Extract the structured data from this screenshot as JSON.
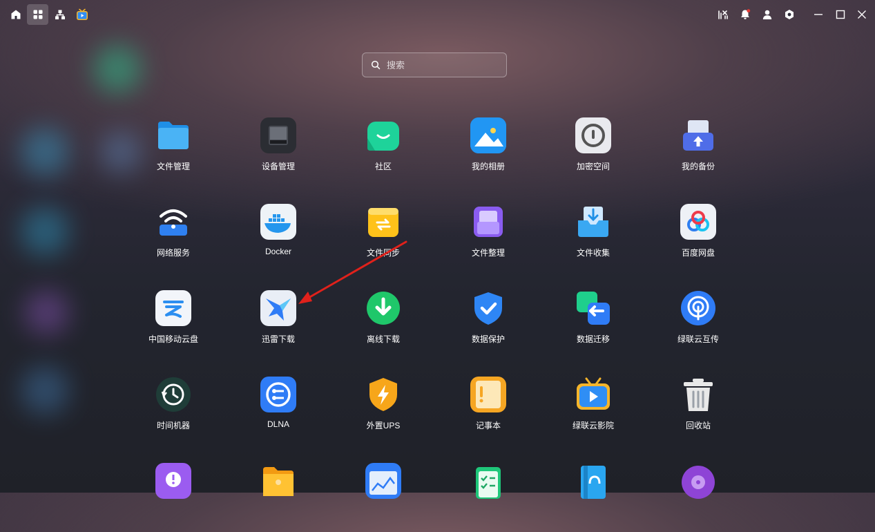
{
  "search": {
    "placeholder": "搜索"
  },
  "apps": [
    {
      "label": "文件管理",
      "icon": "folder-icon"
    },
    {
      "label": "设备管理",
      "icon": "device-icon"
    },
    {
      "label": "社区",
      "icon": "community-icon"
    },
    {
      "label": "我的相册",
      "icon": "album-icon"
    },
    {
      "label": "加密空间",
      "icon": "encrypted-space-icon"
    },
    {
      "label": "我的备份",
      "icon": "backup-icon"
    },
    {
      "label": "网络服务",
      "icon": "network-service-icon"
    },
    {
      "label": "Docker",
      "icon": "docker-icon"
    },
    {
      "label": "文件同步",
      "icon": "file-sync-icon"
    },
    {
      "label": "文件整理",
      "icon": "file-organize-icon"
    },
    {
      "label": "文件收集",
      "icon": "file-collect-icon"
    },
    {
      "label": "百度网盘",
      "icon": "baidu-pan-icon"
    },
    {
      "label": "中国移动云盘",
      "icon": "china-mobile-cloud-icon"
    },
    {
      "label": "迅雷下载",
      "icon": "xunlei-icon"
    },
    {
      "label": "离线下载",
      "icon": "offline-download-icon"
    },
    {
      "label": "数据保护",
      "icon": "data-protect-icon"
    },
    {
      "label": "数据迁移",
      "icon": "data-migrate-icon"
    },
    {
      "label": "绿联云互传",
      "icon": "ugreen-transfer-icon"
    },
    {
      "label": "时间机器",
      "icon": "time-machine-icon"
    },
    {
      "label": "DLNA",
      "icon": "dlna-icon"
    },
    {
      "label": "外置UPS",
      "icon": "ups-icon"
    },
    {
      "label": "记事本",
      "icon": "notepad-icon"
    },
    {
      "label": "绿联云影院",
      "icon": "ugreen-cinema-icon"
    },
    {
      "label": "回收站",
      "icon": "recycle-bin-icon"
    }
  ]
}
